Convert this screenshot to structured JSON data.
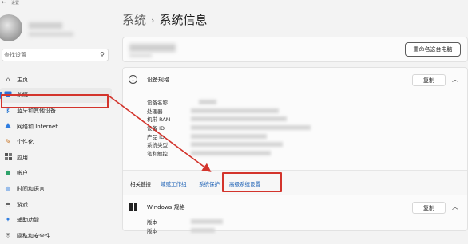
{
  "window": {
    "title": "设置",
    "back_glyph": "←"
  },
  "sidebar": {
    "search": {
      "placeholder": "查找设置",
      "icon": "search-icon"
    },
    "items": [
      {
        "label": "主页",
        "icon": "home-icon",
        "selected": false
      },
      {
        "label": "系统",
        "icon": "monitor-icon",
        "selected": true
      },
      {
        "label": "蓝牙和其他设备",
        "icon": "bluetooth-icon",
        "selected": false
      },
      {
        "label": "网络和 Internet",
        "icon": "wifi-icon",
        "selected": false
      },
      {
        "label": "个性化",
        "icon": "brush-icon",
        "selected": false
      },
      {
        "label": "应用",
        "icon": "apps-icon",
        "selected": false
      },
      {
        "label": "帐户",
        "icon": "account-icon",
        "selected": false
      },
      {
        "label": "时间和语言",
        "icon": "globe-icon",
        "selected": false
      },
      {
        "label": "游戏",
        "icon": "gamepad-icon",
        "selected": false
      },
      {
        "label": "辅助功能",
        "icon": "accessibility-icon",
        "selected": false
      },
      {
        "label": "隐私和安全性",
        "icon": "shield-icon",
        "selected": false
      }
    ]
  },
  "main": {
    "breadcrumb": {
      "parent": "系统",
      "separator": "›",
      "current": "系统信息"
    },
    "device_card": {
      "rename_label": "重命名这台电脑"
    },
    "spec": {
      "icon_glyph": "i",
      "title": "设备规格",
      "copy_label": "复制",
      "chevron": "︿",
      "rows": [
        {
          "label": "设备名称"
        },
        {
          "label": "处理器"
        },
        {
          "label": "机带 RAM"
        },
        {
          "label": "设备 ID"
        },
        {
          "label": "产品 ID"
        },
        {
          "label": "系统类型"
        },
        {
          "label": "笔和触控"
        }
      ]
    },
    "related": {
      "label": "相关链接",
      "links": [
        "域或工作组",
        "系统保护",
        "高级系统设置"
      ]
    },
    "windows_spec": {
      "title": "Windows 规格",
      "copy_label": "复制",
      "chevron": "︿",
      "rows": [
        {
          "label": "版本"
        },
        {
          "label": "版本"
        }
      ]
    }
  },
  "colors": {
    "highlight": "#d3342c",
    "link": "#1a5fb4",
    "accent": "#2a6fd6"
  }
}
